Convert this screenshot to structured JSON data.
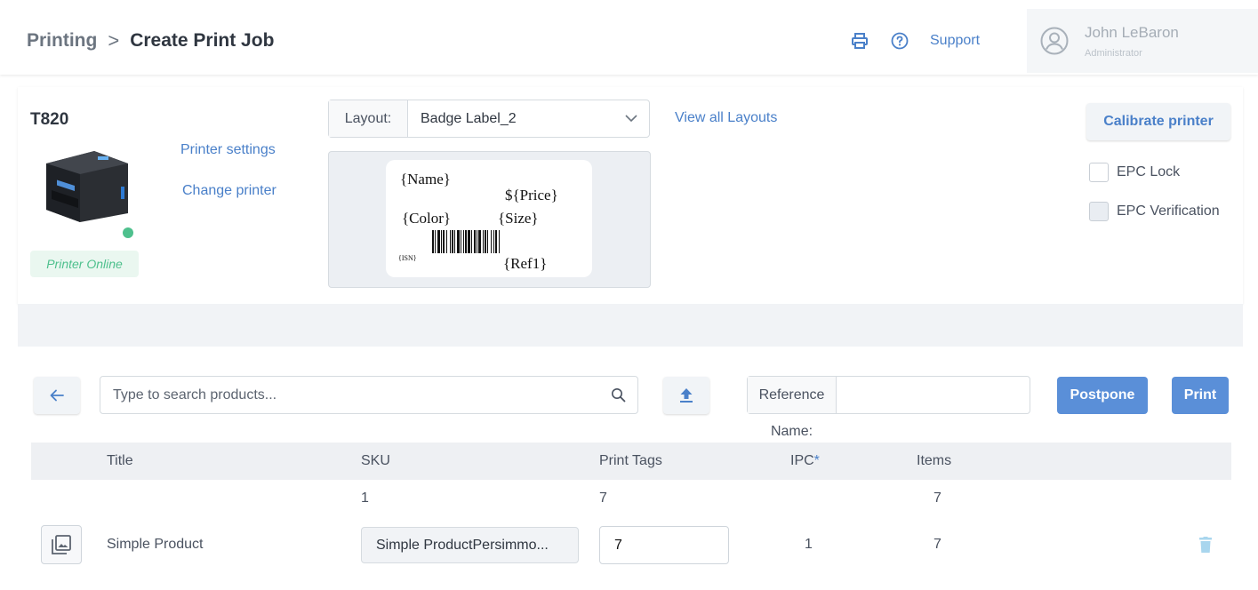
{
  "header": {
    "breadcrumb_root": "Printing",
    "breadcrumb_separator": ">",
    "breadcrumb_current": "Create Print Job",
    "icons": [
      "printer-icon",
      "help-icon"
    ],
    "support_label": "Support",
    "user_name": "John LeBaron",
    "user_role": "Administrator"
  },
  "printer": {
    "model": "T820",
    "status": "Printer Online",
    "settings_label": "Printer settings",
    "change_label": "Change printer"
  },
  "layout": {
    "label": "Layout:",
    "value": "Badge Label_2",
    "view_all_label": "View all Layouts"
  },
  "label_preview": {
    "name": "{Name}",
    "price": "${Price}",
    "color": "{Color}",
    "size": "{Size}",
    "isn": "{ISN}",
    "ref": "{Ref1}"
  },
  "actions": {
    "calibrate_label": "Calibrate printer",
    "epc_lock_label": "EPC Lock",
    "epc_lock_checked": false,
    "epc_verification_label": "EPC Verification",
    "epc_verification_checked": false
  },
  "toolbar": {
    "search_placeholder": "Type to search products...",
    "reference_label": "Reference Name:",
    "reference_value": "",
    "postpone_label": "Postpone",
    "print_label": "Print"
  },
  "table": {
    "columns": [
      "Title",
      "SKU",
      "Print Tags",
      "IPC",
      "Items"
    ],
    "ipc_marker": "*",
    "totals": {
      "sku": "1",
      "print_tags": "7",
      "items": "7"
    },
    "rows": [
      {
        "title": "Simple Product",
        "sku": "Simple ProductPersimmo...",
        "print_tags": "7",
        "ipc": "1",
        "items": "7"
      }
    ]
  },
  "colors": {
    "accent": "#4a80c9",
    "primary_button": "#5a8fd8",
    "online": "#4ec08d",
    "trash": "#a9d6ee"
  }
}
